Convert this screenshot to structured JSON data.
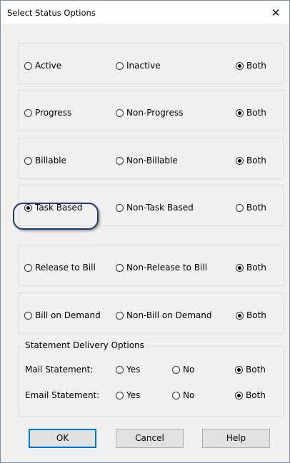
{
  "dialog": {
    "title": "Select Status Options"
  },
  "groups": [
    {
      "options": [
        "Active",
        "Inactive",
        "Both"
      ],
      "selected": 2
    },
    {
      "options": [
        "Progress",
        "Non-Progress",
        "Both"
      ],
      "selected": 2
    },
    {
      "options": [
        "Billable",
        "Non-Billable",
        "Both"
      ],
      "selected": 2
    },
    {
      "options": [
        "Task Based",
        "Non-Task Based",
        "Both"
      ],
      "selected": 0
    },
    {
      "options": [
        "Release to Bill",
        "Non-Release to Bill",
        "Both"
      ],
      "selected": 2
    },
    {
      "options": [
        "Bill on Demand",
        "Non-Bill on Demand",
        "Both"
      ],
      "selected": 2
    }
  ],
  "statement": {
    "legend": "Statement Delivery Options",
    "rows": [
      {
        "label": "Mail Statement:",
        "options": [
          "Yes",
          "No",
          "Both"
        ],
        "selected": 2
      },
      {
        "label": "Email Statement:",
        "options": [
          "Yes",
          "No",
          "Both"
        ],
        "selected": 2
      }
    ]
  },
  "buttons": {
    "ok": "OK",
    "cancel": "Cancel",
    "help": "Help"
  }
}
